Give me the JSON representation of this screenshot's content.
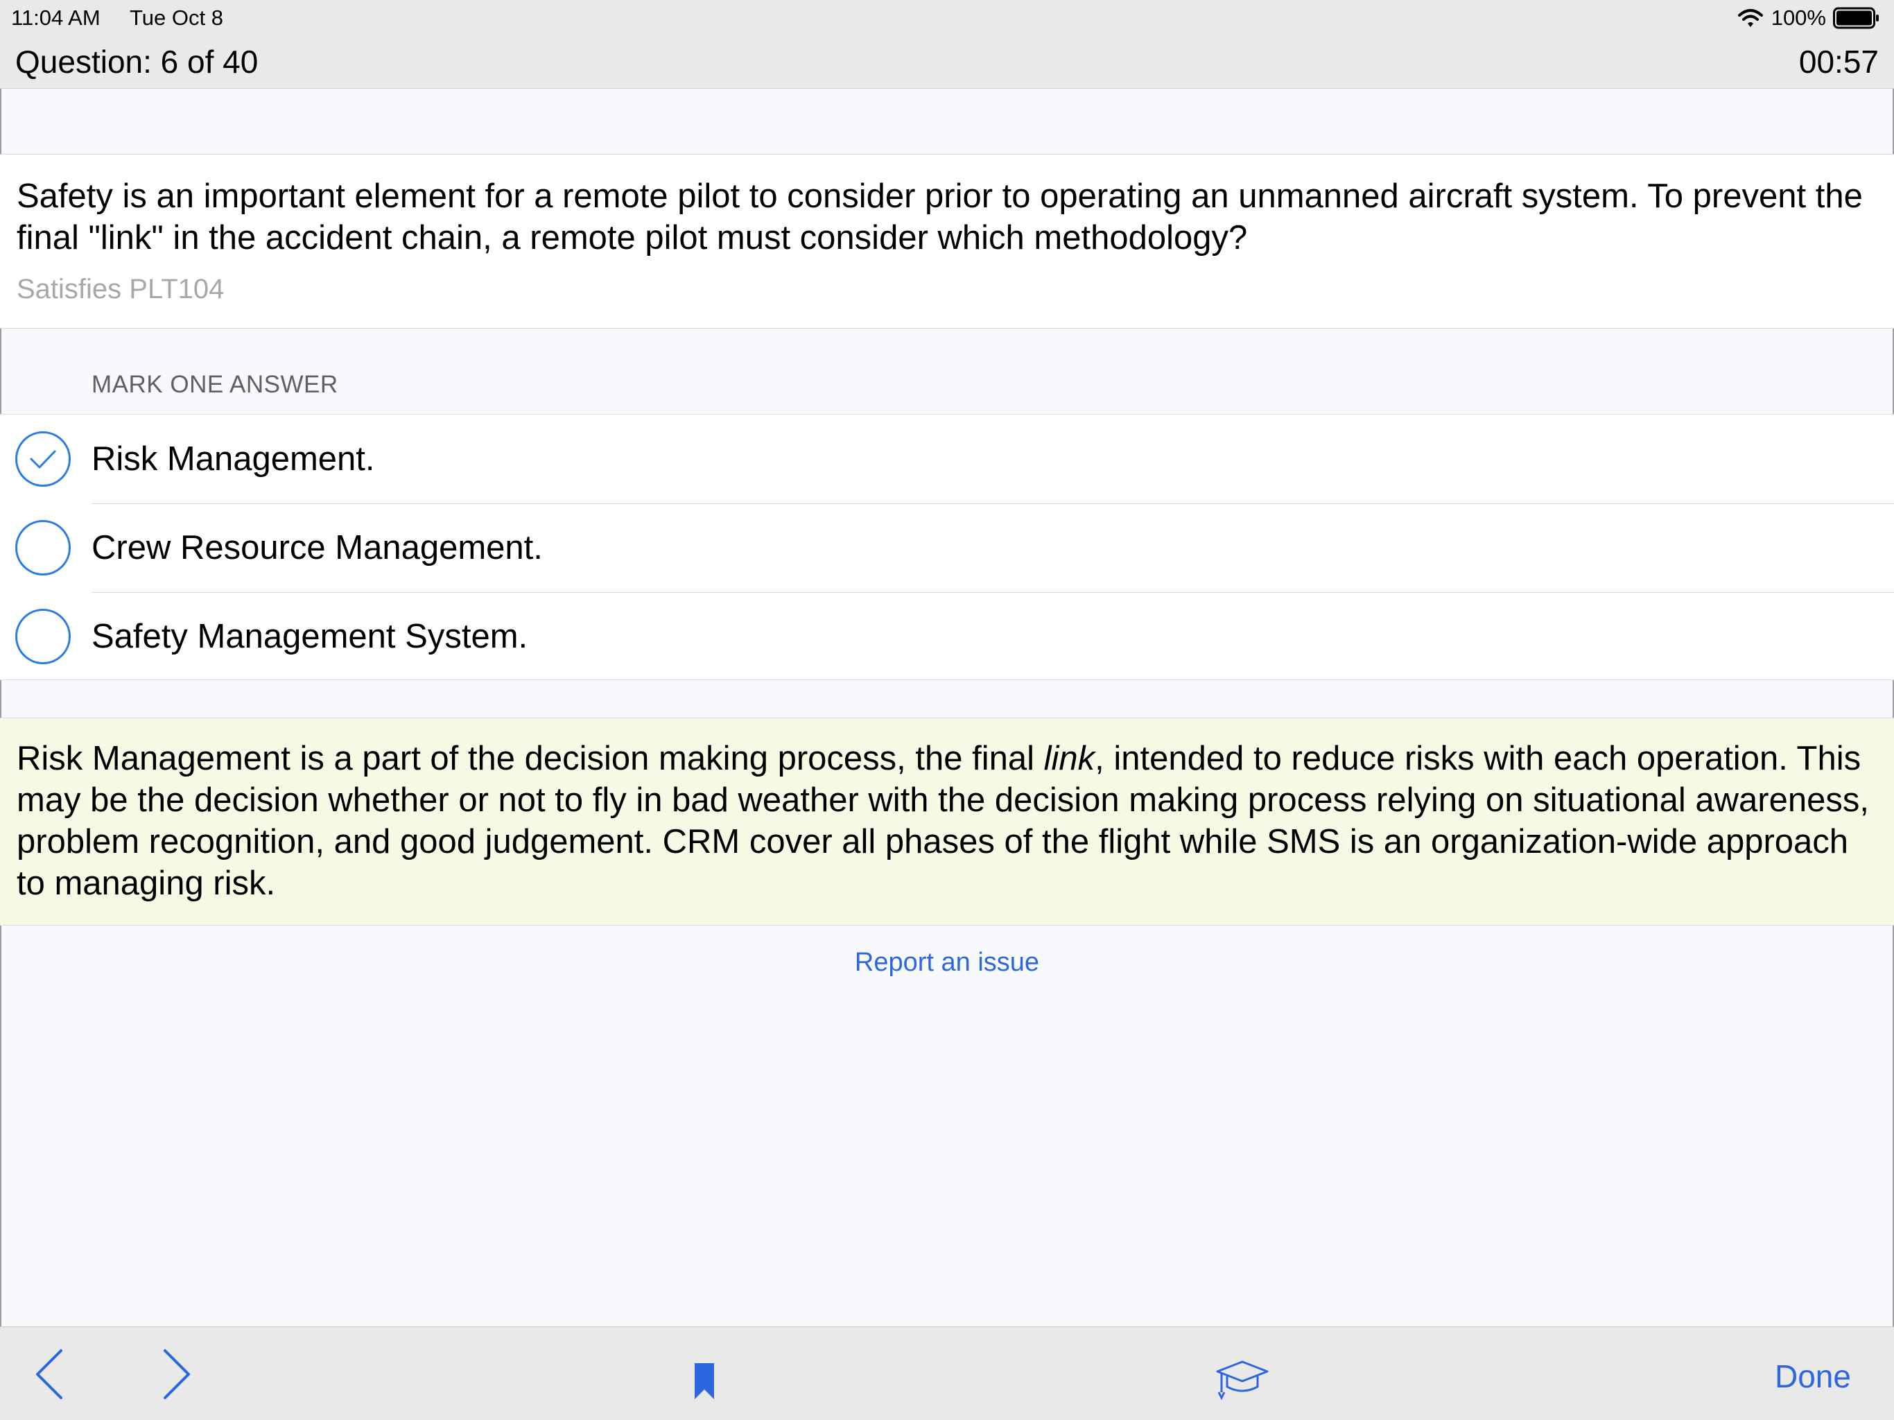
{
  "status_bar": {
    "time": "11:04 AM",
    "date": "Tue Oct 8",
    "battery": "100%"
  },
  "header": {
    "question_counter": "Question: 6 of 40",
    "timer": "00:57"
  },
  "question": {
    "text": "Safety is an important element for a remote pilot to consider prior to operating an unmanned aircraft system. To prevent the final \"link\" in the accident chain, a remote pilot must consider which methodology?",
    "reference": "Satisfies PLT104"
  },
  "answers": {
    "header": "MARK ONE ANSWER",
    "options": [
      {
        "label": "Risk Management.",
        "selected": true
      },
      {
        "label": "Crew Resource Management.",
        "selected": false
      },
      {
        "label": "Safety Management System.",
        "selected": false
      }
    ]
  },
  "explanation": {
    "before_italic": "Risk Management is a part of the decision making process, the final ",
    "italic": "link",
    "after_italic": ", intended to reduce risks with each operation. This may be the decision whether or not to fly in bad weather with the decision making process relying on situational awareness, problem recognition, and good judgement. CRM cover all phases of the flight while SMS is an organization-wide approach to managing risk."
  },
  "report_link": "Report an issue",
  "toolbar": {
    "prev_icon": "chevron-left-icon",
    "next_icon": "chevron-right-icon",
    "bookmark_icon": "bookmark-icon",
    "study_icon": "graduation-cap-icon",
    "done_label": "Done"
  },
  "colors": {
    "accent": "#2d67e0",
    "explanation_bg": "#f7f9e5",
    "bar_bg": "#e9e9ea"
  }
}
